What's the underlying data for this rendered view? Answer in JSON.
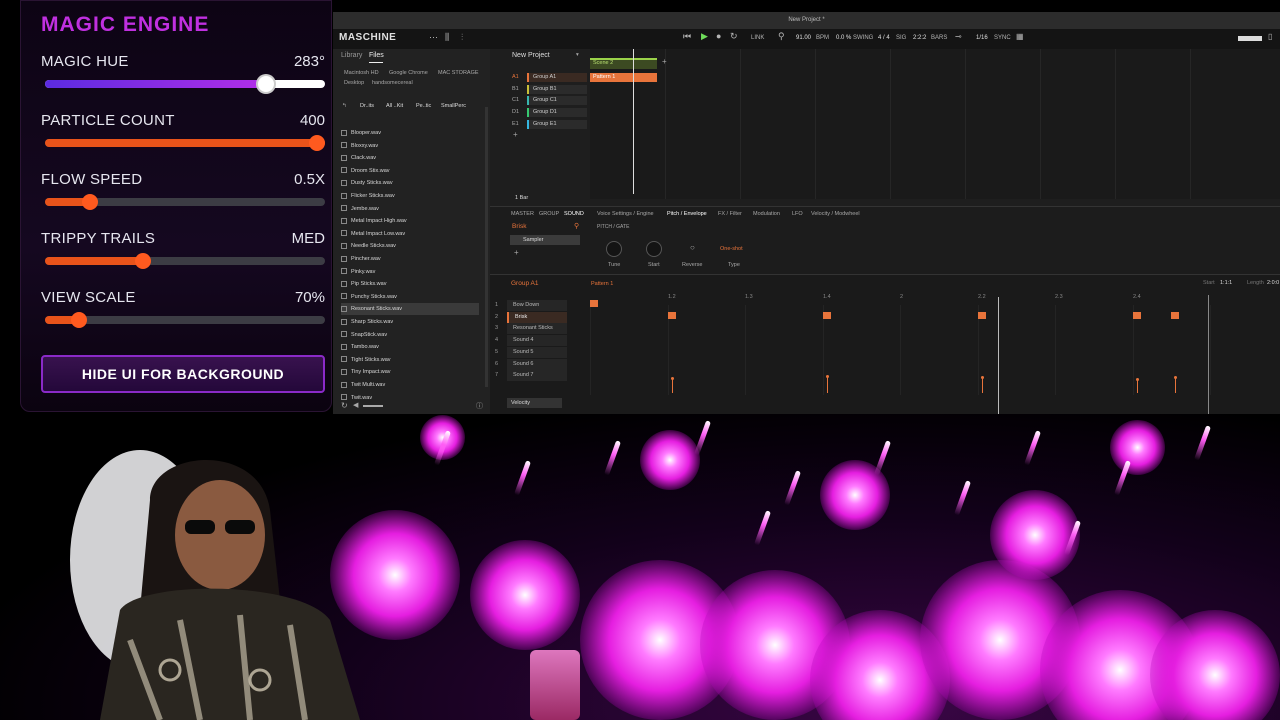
{
  "magic_panel": {
    "title": "MAGIC ENGINE",
    "controls": [
      {
        "label": "MAGIC HUE",
        "value": "283°",
        "level": 0.79
      },
      {
        "label": "PARTICLE COUNT",
        "value": "400",
        "level": 1.0
      },
      {
        "label": "FLOW SPEED",
        "value": "0.5X",
        "level": 0.16
      },
      {
        "label": "TRIPPY TRAILS",
        "value": "MED",
        "level": 0.35
      },
      {
        "label": "VIEW SCALE",
        "value": "70%",
        "level": 0.12
      }
    ],
    "hide_button": "HIDE UI FOR BACKGROUND",
    "colors": {
      "title": "#c030e0",
      "track_hue": "#7a2cf0",
      "track_other": "#e8531a",
      "knob": "#ff5a1f"
    }
  },
  "maschine": {
    "window_title": "New Project *",
    "logo": "MASCHINE",
    "transport": {
      "tempo": "91.00",
      "tempo_unit": "BPM",
      "swing": "0.0 %",
      "swing_label": "SWING",
      "signature": "4 / 4",
      "sig_label": "SIG",
      "position": "2:2:2",
      "pos_label": "BARS",
      "link": "LINK",
      "quantize": "1/16",
      "sync": "SYNC"
    },
    "browser": {
      "tabs": [
        "Library",
        "Files"
      ],
      "locations": [
        "Macintosh HD",
        "Google Chrome",
        "MAC STORAGE",
        "Desktop",
        "handsomecereal"
      ],
      "path": [
        "Dr..its",
        "All ..Kit",
        "Pe..tic",
        "SmallPerc"
      ],
      "files": [
        "Blooper.wav",
        "Bloxxy.wav",
        "Clack.wav",
        "Droom Stix.wav",
        "Dusty Sticks.wav",
        "Flicker Sticks.wav",
        "Jembe.wav",
        "Metal Impact High.wav",
        "Metal Impact Low.wav",
        "Needle Sticks.wav",
        "Pincher.wav",
        "Pinky.wav",
        "Pip Sticks.wav",
        "Punchy Sticks.wav",
        "Resonant Sticks.wav",
        "Sharp Sticks.wav",
        "SnapStick.wav",
        "Tambo.wav",
        "Tight Sticks.wav",
        "Tiny Impact.wav",
        "Twit Multi.wav",
        "Twit.wav"
      ],
      "selected_file": "Resonant Sticks.wav"
    },
    "project": {
      "name": "New Project",
      "groups": [
        {
          "id": "A1",
          "name": "Group A1",
          "color": "#e8743b"
        },
        {
          "id": "B1",
          "name": "Group B1",
          "color": "#c9c13a"
        },
        {
          "id": "C1",
          "name": "Group C1",
          "color": "#38b7b0"
        },
        {
          "id": "D1",
          "name": "Group D1",
          "color": "#36c870"
        },
        {
          "id": "E1",
          "name": "Group E1",
          "color": "#34b6e0"
        }
      ]
    },
    "arranger": {
      "scene": "Scene 2",
      "pattern": "Pattern 1",
      "length": "1 Bar"
    },
    "editor": {
      "tabs_left": [
        "MASTER",
        "GROUP",
        "SOUND"
      ],
      "sound_name": "Brisk",
      "plugin": "Sampler",
      "tabs": [
        "Voice Settings / Engine",
        "Pitch / Envelope",
        "FX / Filter",
        "Modulation",
        "LFO",
        "Velocity / Modwheel"
      ],
      "section": "PITCH / GATE",
      "knobs": [
        "Tune",
        "Start",
        "Reverse",
        "Type"
      ],
      "type_value": "One-shot"
    },
    "pattern_editor": {
      "group": "Group A1",
      "pattern": "Pattern 1",
      "start_label": "Start",
      "start_value": "1:1:1",
      "length_label": "Length",
      "length_value": "2:0:0",
      "ruler": [
        "1.2",
        "1.3",
        "1.4",
        "2",
        "2.2",
        "2.3",
        "2.4"
      ],
      "sounds": [
        "Bow Down",
        "Brisk",
        "Resonant Sticks",
        "Sound 4",
        "Sound 5",
        "Sound 6",
        "Sound 7"
      ],
      "velocity_label": "Velocity",
      "steps": [
        {
          "row": 0,
          "pos": 0.0
        },
        {
          "row": 1,
          "pos": 0.125
        },
        {
          "row": 1,
          "pos": 0.375
        },
        {
          "row": 1,
          "pos": 0.625
        },
        {
          "row": 1,
          "pos": 0.875
        },
        {
          "row": 1,
          "pos": 0.9375
        }
      ],
      "velocities": [
        0.75,
        0.85,
        0.8,
        0.7,
        0.8
      ]
    }
  }
}
